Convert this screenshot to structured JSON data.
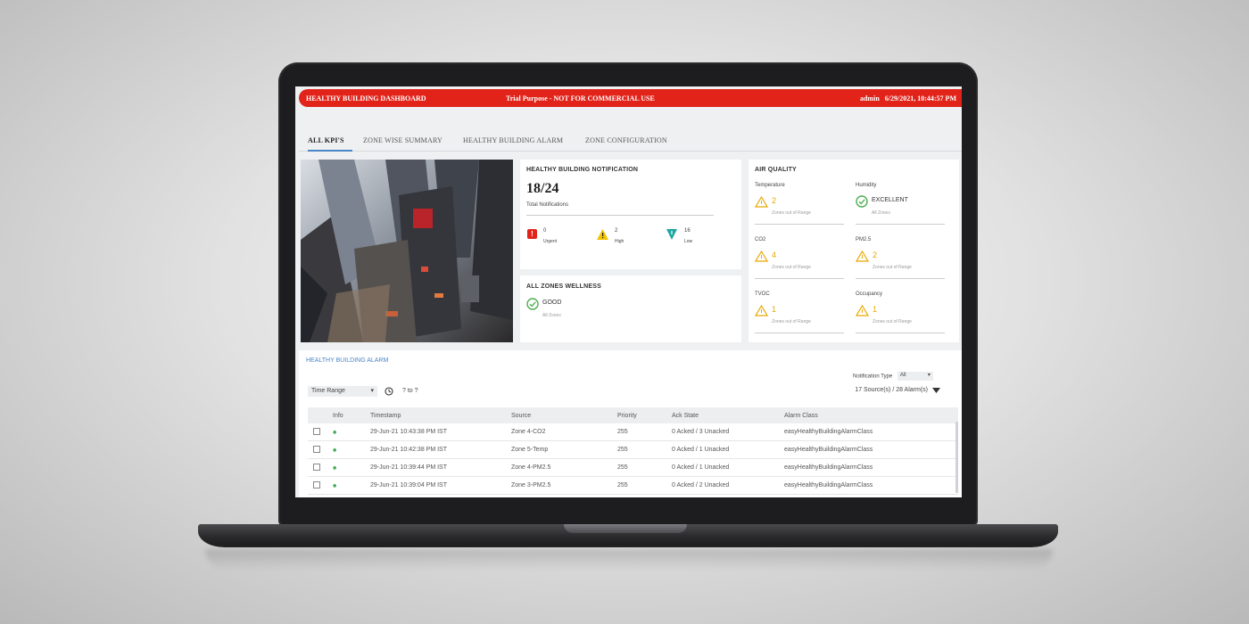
{
  "header": {
    "title": "HEALTHY BUILDING DASHBOARD",
    "notice": "Trial Purpose - NOT FOR COMMERCIAL USE",
    "user": "admin",
    "datetime": "6/29/2021, 10:44:57 PM"
  },
  "tabs": [
    {
      "label": "ALL KPI'S",
      "active": true
    },
    {
      "label": "ZONE WISE SUMMARY",
      "active": false
    },
    {
      "label": "HEALTHY BUILDING ALARM",
      "active": false
    },
    {
      "label": "ZONE CONFIGURATION",
      "active": false
    }
  ],
  "notification": {
    "title": "HEALTHY BUILDING NOTIFICATION",
    "count": "18/24",
    "count_label": "Total Notifications",
    "levels": [
      {
        "value": "0",
        "label": "Urgent",
        "color": "#e2231a",
        "icon": "exclamation-icon"
      },
      {
        "value": "2",
        "label": "High",
        "color": "#f2c200",
        "icon": "warning-icon"
      },
      {
        "value": "16",
        "label": "Low",
        "color": "#1fa6a0",
        "icon": "down-arrow-icon"
      }
    ]
  },
  "wellness": {
    "title": "ALL ZONES WELLNESS",
    "status": "GOOD",
    "sub": "All Zones"
  },
  "air_quality": {
    "title": "AIR QUALITY",
    "items": [
      {
        "name": "Temperature",
        "value": "2",
        "sub": "Zones out of Range",
        "icon": "warning-icon"
      },
      {
        "name": "Humidity",
        "value": "EXCELLENT",
        "sub": "All Zones",
        "icon": "check-circle-icon"
      },
      {
        "name": "CO2",
        "value": "4",
        "sub": "Zones out of Range",
        "icon": "warning-icon"
      },
      {
        "name": "PM2.5",
        "value": "2",
        "sub": "Zones out of Range",
        "icon": "warning-icon"
      },
      {
        "name": "TVOC",
        "value": "1",
        "sub": "Zones out of Range",
        "icon": "warning-icon"
      },
      {
        "name": "Occupancy",
        "value": "1",
        "sub": "Zones out of Range",
        "icon": "warning-icon"
      }
    ]
  },
  "alarm": {
    "title": "HEALTHY BUILDING ALARM",
    "notification_type_label": "Notification Type",
    "notification_type_value": "All",
    "time_range_label": "Time Range",
    "time_range_value": "? to ?",
    "summary": "17 Source(s) / 28 Alarm(s)",
    "columns": [
      "",
      "Info",
      "Timestamp",
      "Source",
      "Priority",
      "Ack State",
      "Alarm Class"
    ],
    "rows": [
      {
        "timestamp": "29-Jun-21 10:43:38 PM IST",
        "source": "Zone 4-CO2",
        "priority": "255",
        "ack": "0 Acked / 3 Unacked",
        "class": "easyHealthyBuildingAlarmClass"
      },
      {
        "timestamp": "29-Jun-21 10:42:38 PM IST",
        "source": "Zone 5-Temp",
        "priority": "255",
        "ack": "0 Acked / 1 Unacked",
        "class": "easyHealthyBuildingAlarmClass"
      },
      {
        "timestamp": "29-Jun-21 10:39:44 PM IST",
        "source": "Zone 4-PM2.5",
        "priority": "255",
        "ack": "0 Acked / 1 Unacked",
        "class": "easyHealthyBuildingAlarmClass"
      },
      {
        "timestamp": "29-Jun-21 10:39:04 PM IST",
        "source": "Zone 3-PM2.5",
        "priority": "255",
        "ack": "0 Acked / 2 Unacked",
        "class": "easyHealthyBuildingAlarmClass"
      }
    ]
  },
  "colors": {
    "accent": "#e2231a",
    "link": "#4a86c5",
    "warning": "#e9a800",
    "ok": "#4caf50"
  }
}
